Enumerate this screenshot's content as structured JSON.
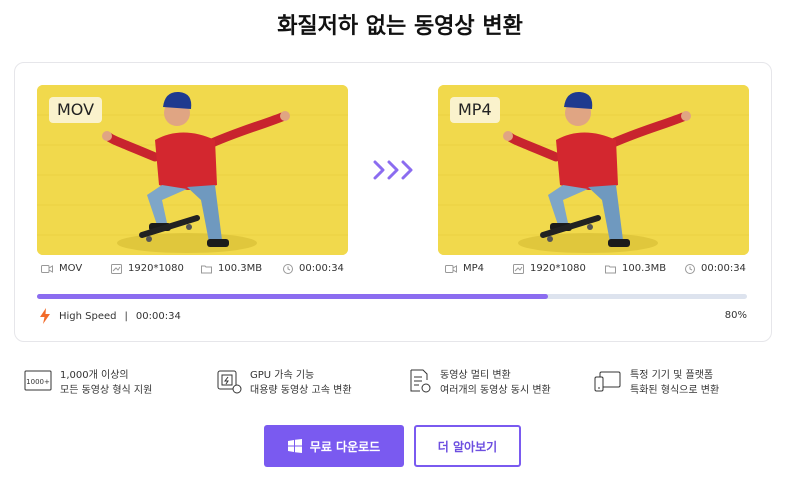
{
  "page": {
    "title": "화질저하 없는 동영상 변환"
  },
  "source": {
    "badge": "MOV",
    "format": "MOV",
    "resolution": "1920*1080",
    "size": "100.3MB",
    "duration": "00:00:34"
  },
  "target": {
    "badge": "MP4",
    "format": "MP4",
    "resolution": "1920*1080",
    "size": "100.3MB",
    "duration": "00:00:34"
  },
  "progress": {
    "fraction": 0.72,
    "speed_label": "High Speed",
    "separator": "|",
    "elapsed": "00:00:34",
    "percent_label": "80%"
  },
  "features": [
    {
      "icon": "format-1000-icon",
      "line1": "1,000개 이상의",
      "line2": "모든 동영상 형식 지원"
    },
    {
      "icon": "gpu-chip-icon",
      "line1": "GPU 가속 기능",
      "line2": "대용량 동영상 고속 변환"
    },
    {
      "icon": "batch-list-icon",
      "line1": "동영상 멀티 변환",
      "line2": "여러개의 동영상 동시 변환"
    },
    {
      "icon": "devices-icon",
      "line1": "특정 기기 및 플랫폼",
      "line2": "특화된 형식으로 변환"
    }
  ],
  "buttons": {
    "download_label": "무료 다운로드",
    "learn_more_label": "더 알아보기"
  },
  "colors": {
    "accent": "#7a5af0",
    "progress_fill": "#8b6cf0",
    "progress_track": "#dde3ee",
    "lightning": "#f26b2a",
    "image_background": "#f1d94c"
  }
}
